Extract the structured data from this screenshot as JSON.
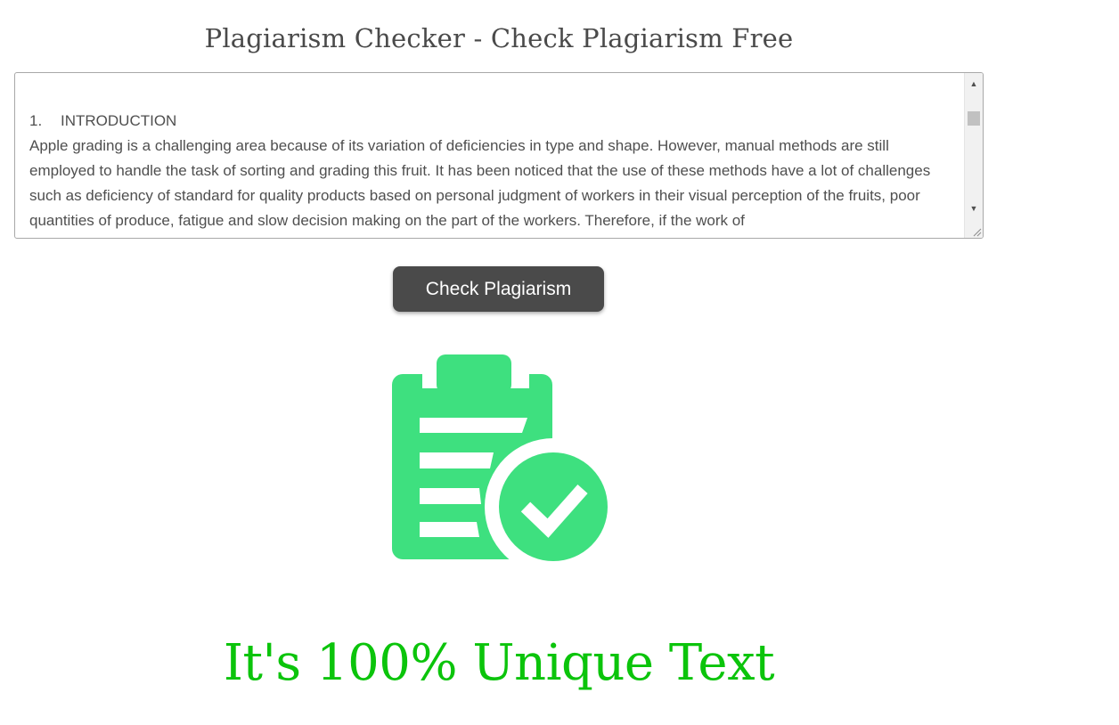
{
  "page": {
    "title": "Plagiarism Checker - Check Plagiarism Free"
  },
  "editor": {
    "heading_number": "1.",
    "heading_text": "INTRODUCTION",
    "body_text": "Apple grading is a challenging area because of its variation of deficiencies in type and shape. However, manual methods are still employed to handle the task of sorting and grading this fruit. It has been noticed that the use of these methods have a lot of challenges such as deficiency of standard for quality products based on personal judgment of workers in their visual perception of the fruits, poor quantities of produce, fatigue and slow decision making on the part of the workers. Therefore, if the work of"
  },
  "actions": {
    "check_label": "Check Plagiarism"
  },
  "result": {
    "icon": "clipboard-check-icon",
    "message": "It's 100% Unique Text",
    "icon_color": "#3ee07f",
    "message_color": "#0bc40b"
  },
  "colors": {
    "button_bg": "#4a4a4a",
    "title_text": "#4a4a4a"
  }
}
